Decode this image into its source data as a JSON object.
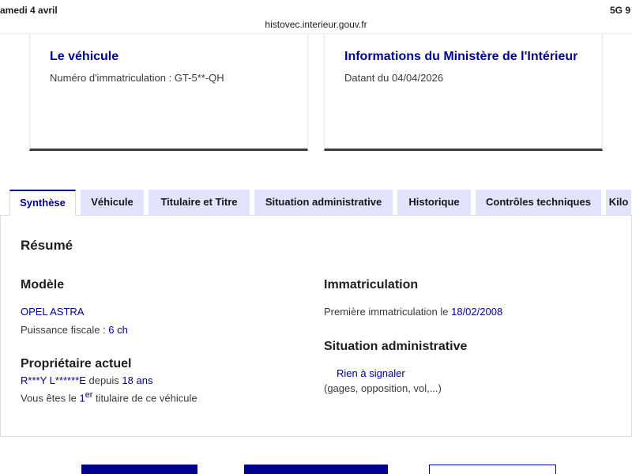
{
  "status": {
    "date": "amedi 4 avril",
    "signal": "5G 9"
  },
  "url": "histovec.interieur.gouv.fr",
  "card_vehicle": {
    "title": "Le véhicule",
    "plate_label": "Numéro d'immatriculation : GT-5**-QH"
  },
  "card_ministry": {
    "title": "Informations du Ministère de l'Intérieur",
    "date": "Datant du 04/04/2026"
  },
  "tabs": [
    "Synthèse",
    "Véhicule",
    "Titulaire et Titre",
    "Situation administrative",
    "Historique",
    "Contrôles techniques",
    "Kilo"
  ],
  "summary": {
    "title": "Résumé",
    "model_heading": "Modèle",
    "model": "OPEL ASTRA",
    "power_label": "Puissance fiscale : ",
    "power": "6 ch",
    "owner_heading": "Propriétaire actuel",
    "owner": "R***Y L******E",
    "since_label": " depuis ",
    "since": "18 ans",
    "holder_pre": "Vous êtes le ",
    "holder_num": "1",
    "holder_sup": "er",
    "holder_post": " titulaire de ce véhicule",
    "reg_heading": "Immatriculation",
    "reg_label": "Première immatriculation le ",
    "reg_date": "18/02/2008",
    "admin_heading": "Situation administrative",
    "admin_status": "Rien à signaler",
    "admin_note": "(gages, opposition, vol,...)"
  }
}
